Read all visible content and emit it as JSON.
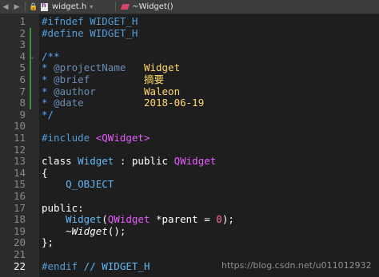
{
  "tabbar": {
    "file_name": "widget.h",
    "func_name": "~Widget()",
    "back_glyph": "◀",
    "forward_glyph": "▶",
    "lock_glyph": "🔒",
    "dropdown_glyph": "▾"
  },
  "line_numbers": [
    "1",
    "2",
    "3",
    "4",
    "5",
    "6",
    "7",
    "8",
    "9",
    "10",
    "11",
    "12",
    "13",
    "14",
    "15",
    "16",
    "17",
    "18",
    "19",
    "20",
    "21",
    "22"
  ],
  "current_line": "22",
  "code": {
    "l1_directive": "#ifndef",
    "l1_name": " WIDGET_H",
    "l2_directive": "#define",
    "l2_name": " WIDGET_H",
    "l4": "/**",
    "l5_star": "* ",
    "l5_tag": "@projectName",
    "l5_val": "   Widget",
    "l6_star": "* ",
    "l6_tag": "@brief",
    "l6_val": "         摘要",
    "l7_star": "* ",
    "l7_tag": "@author",
    "l7_val": "        Waleon",
    "l8_star": "* ",
    "l8_tag": "@date",
    "l8_val": "          2018-06-19",
    "l9": "*/",
    "l11_directive": "#include",
    "l11_header": " <QWidget>",
    "l13_kw": "class",
    "l13_name": " Widget",
    "l13_colon": " : ",
    "l13_access": "public",
    "l13_base": " QWidget",
    "l14": "{",
    "l15": "    Q_OBJECT",
    "l17": "public:",
    "l18_indent": "    ",
    "l18_ctor": "Widget",
    "l18_open": "(",
    "l18_type": "QWidget",
    "l18_param": " *parent = ",
    "l18_zero": "0",
    "l18_end": ");",
    "l19_indent": "    ",
    "l19_dtor": "~Widget",
    "l19_end": "();",
    "l20": "};",
    "l22_directive": "#endif",
    "l22_comment": " // WIDGET_H"
  },
  "watermark": "https://blog.csdn.net/u011012932",
  "colors": {
    "background": "#1e1e1e",
    "gutter": "#2b2b2b",
    "preprocessor": "#569cd6",
    "class_name": "#62b8f6",
    "base_class": "#e65cff",
    "comment_value": "#ffd866",
    "number": "#ff6b9a",
    "change_marker": "#3e8e41"
  }
}
